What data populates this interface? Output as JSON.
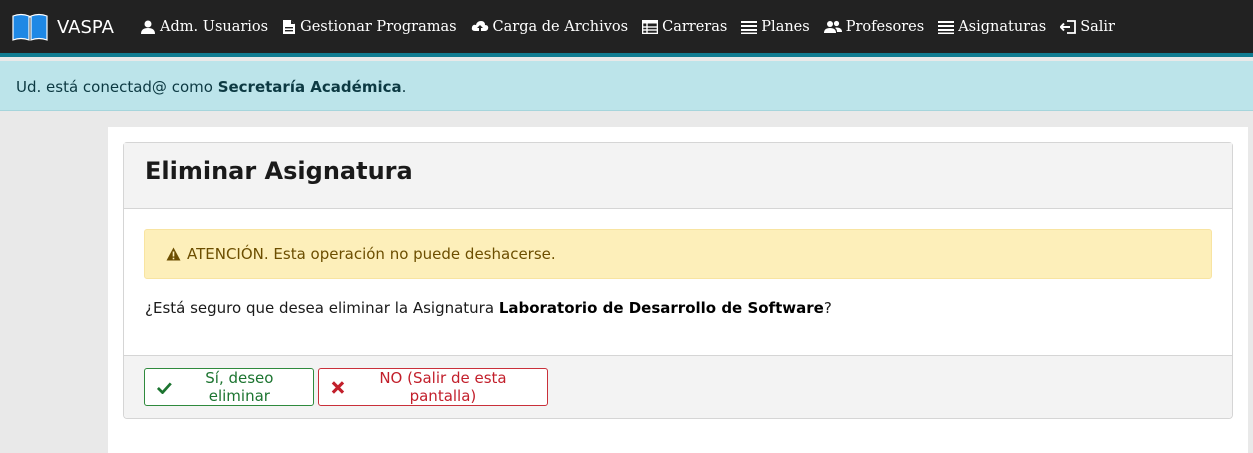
{
  "brand": {
    "name": "VASPA",
    "icon": "open-book-icon"
  },
  "nav": [
    {
      "label": "Adm. Usuarios",
      "icon": "user-icon"
    },
    {
      "label": "Gestionar Programas",
      "icon": "document-icon"
    },
    {
      "label": "Carga de Archivos",
      "icon": "cloud-upload-icon"
    },
    {
      "label": "Carreras",
      "icon": "table-icon"
    },
    {
      "label": "Planes",
      "icon": "list-icon"
    },
    {
      "label": "Profesores",
      "icon": "users-icon"
    },
    {
      "label": "Asignaturas",
      "icon": "list-icon"
    },
    {
      "label": "Salir",
      "icon": "logout-icon"
    }
  ],
  "session": {
    "prefix": "Ud. está conectad@ como ",
    "role": "Secretaría Académica",
    "suffix": "."
  },
  "card": {
    "title": "Eliminar Asignatura",
    "warning": "ATENCIÓN. Esta operación no puede deshacerse.",
    "question_prefix": "¿Está seguro que desea eliminar la Asignatura ",
    "subject": "Laboratorio de Desarrollo de Software",
    "question_suffix": "?",
    "confirm_label": "Sí, deseo eliminar",
    "cancel_label": "NO (Salir de esta pantalla)"
  },
  "colors": {
    "navbar": "#222222",
    "accent": "#107c91",
    "info_bg": "#bce4ea",
    "warning_bg": "#fdefba",
    "success": "#1c7430",
    "danger": "#c21f2b"
  }
}
